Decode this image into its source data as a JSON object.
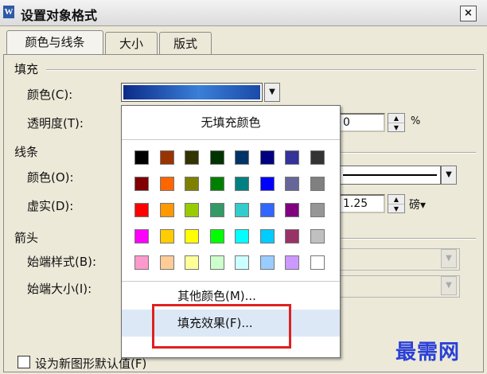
{
  "window": {
    "title": "设置对象格式",
    "app_icon_letter": "W",
    "close_label": "×"
  },
  "tabs": [
    {
      "label": "颜色与线条",
      "active": true
    },
    {
      "label": "大小",
      "active": false
    },
    {
      "label": "版式",
      "active": false
    }
  ],
  "fill": {
    "section_label": "填充",
    "color_label": "颜色(C):",
    "color_value": "blue-gradient",
    "transparency_label": "透明度(T):",
    "transparency_value": "0",
    "transparency_unit": "%"
  },
  "line": {
    "section_label": "线条",
    "color_label": "颜色(O):",
    "dash_label": "虚实(D):",
    "weight_value": "1.25",
    "weight_unit": "磅▾"
  },
  "arrows": {
    "section_label": "箭头",
    "start_style_label": "始端样式(B):",
    "start_size_label": "始端大小(I):"
  },
  "default_checkbox_label": "设为新图形默认值(F)",
  "popup": {
    "no_fill_label": "无填充颜色",
    "swatches": [
      [
        "#000000",
        "#993300",
        "#333300",
        "#003300",
        "#003366",
        "#000080",
        "#333399",
        "#333333"
      ],
      [
        "#800000",
        "#ff6600",
        "#808000",
        "#008000",
        "#008080",
        "#0000ff",
        "#666699",
        "#808080"
      ],
      [
        "#ff0000",
        "#ff9900",
        "#99cc00",
        "#339966",
        "#33cccc",
        "#3366ff",
        "#800080",
        "#969696"
      ],
      [
        "#ff00ff",
        "#ffcc00",
        "#ffff00",
        "#00ff00",
        "#00ffff",
        "#00ccff",
        "#993366",
        "#c0c0c0"
      ],
      [
        "#ff99cc",
        "#ffcc99",
        "#ffff99",
        "#ccffcc",
        "#ccffff",
        "#99ccff",
        "#cc99ff",
        "#ffffff"
      ]
    ],
    "more_colors_label": "其他颜色(M)...",
    "fill_effects_label": "填充效果(F)..."
  },
  "watermark": "最需网",
  "colors": {
    "highlight_box": "#e02020",
    "menu_highlight": "#dce8f6",
    "watermark": "#2a40d8"
  }
}
